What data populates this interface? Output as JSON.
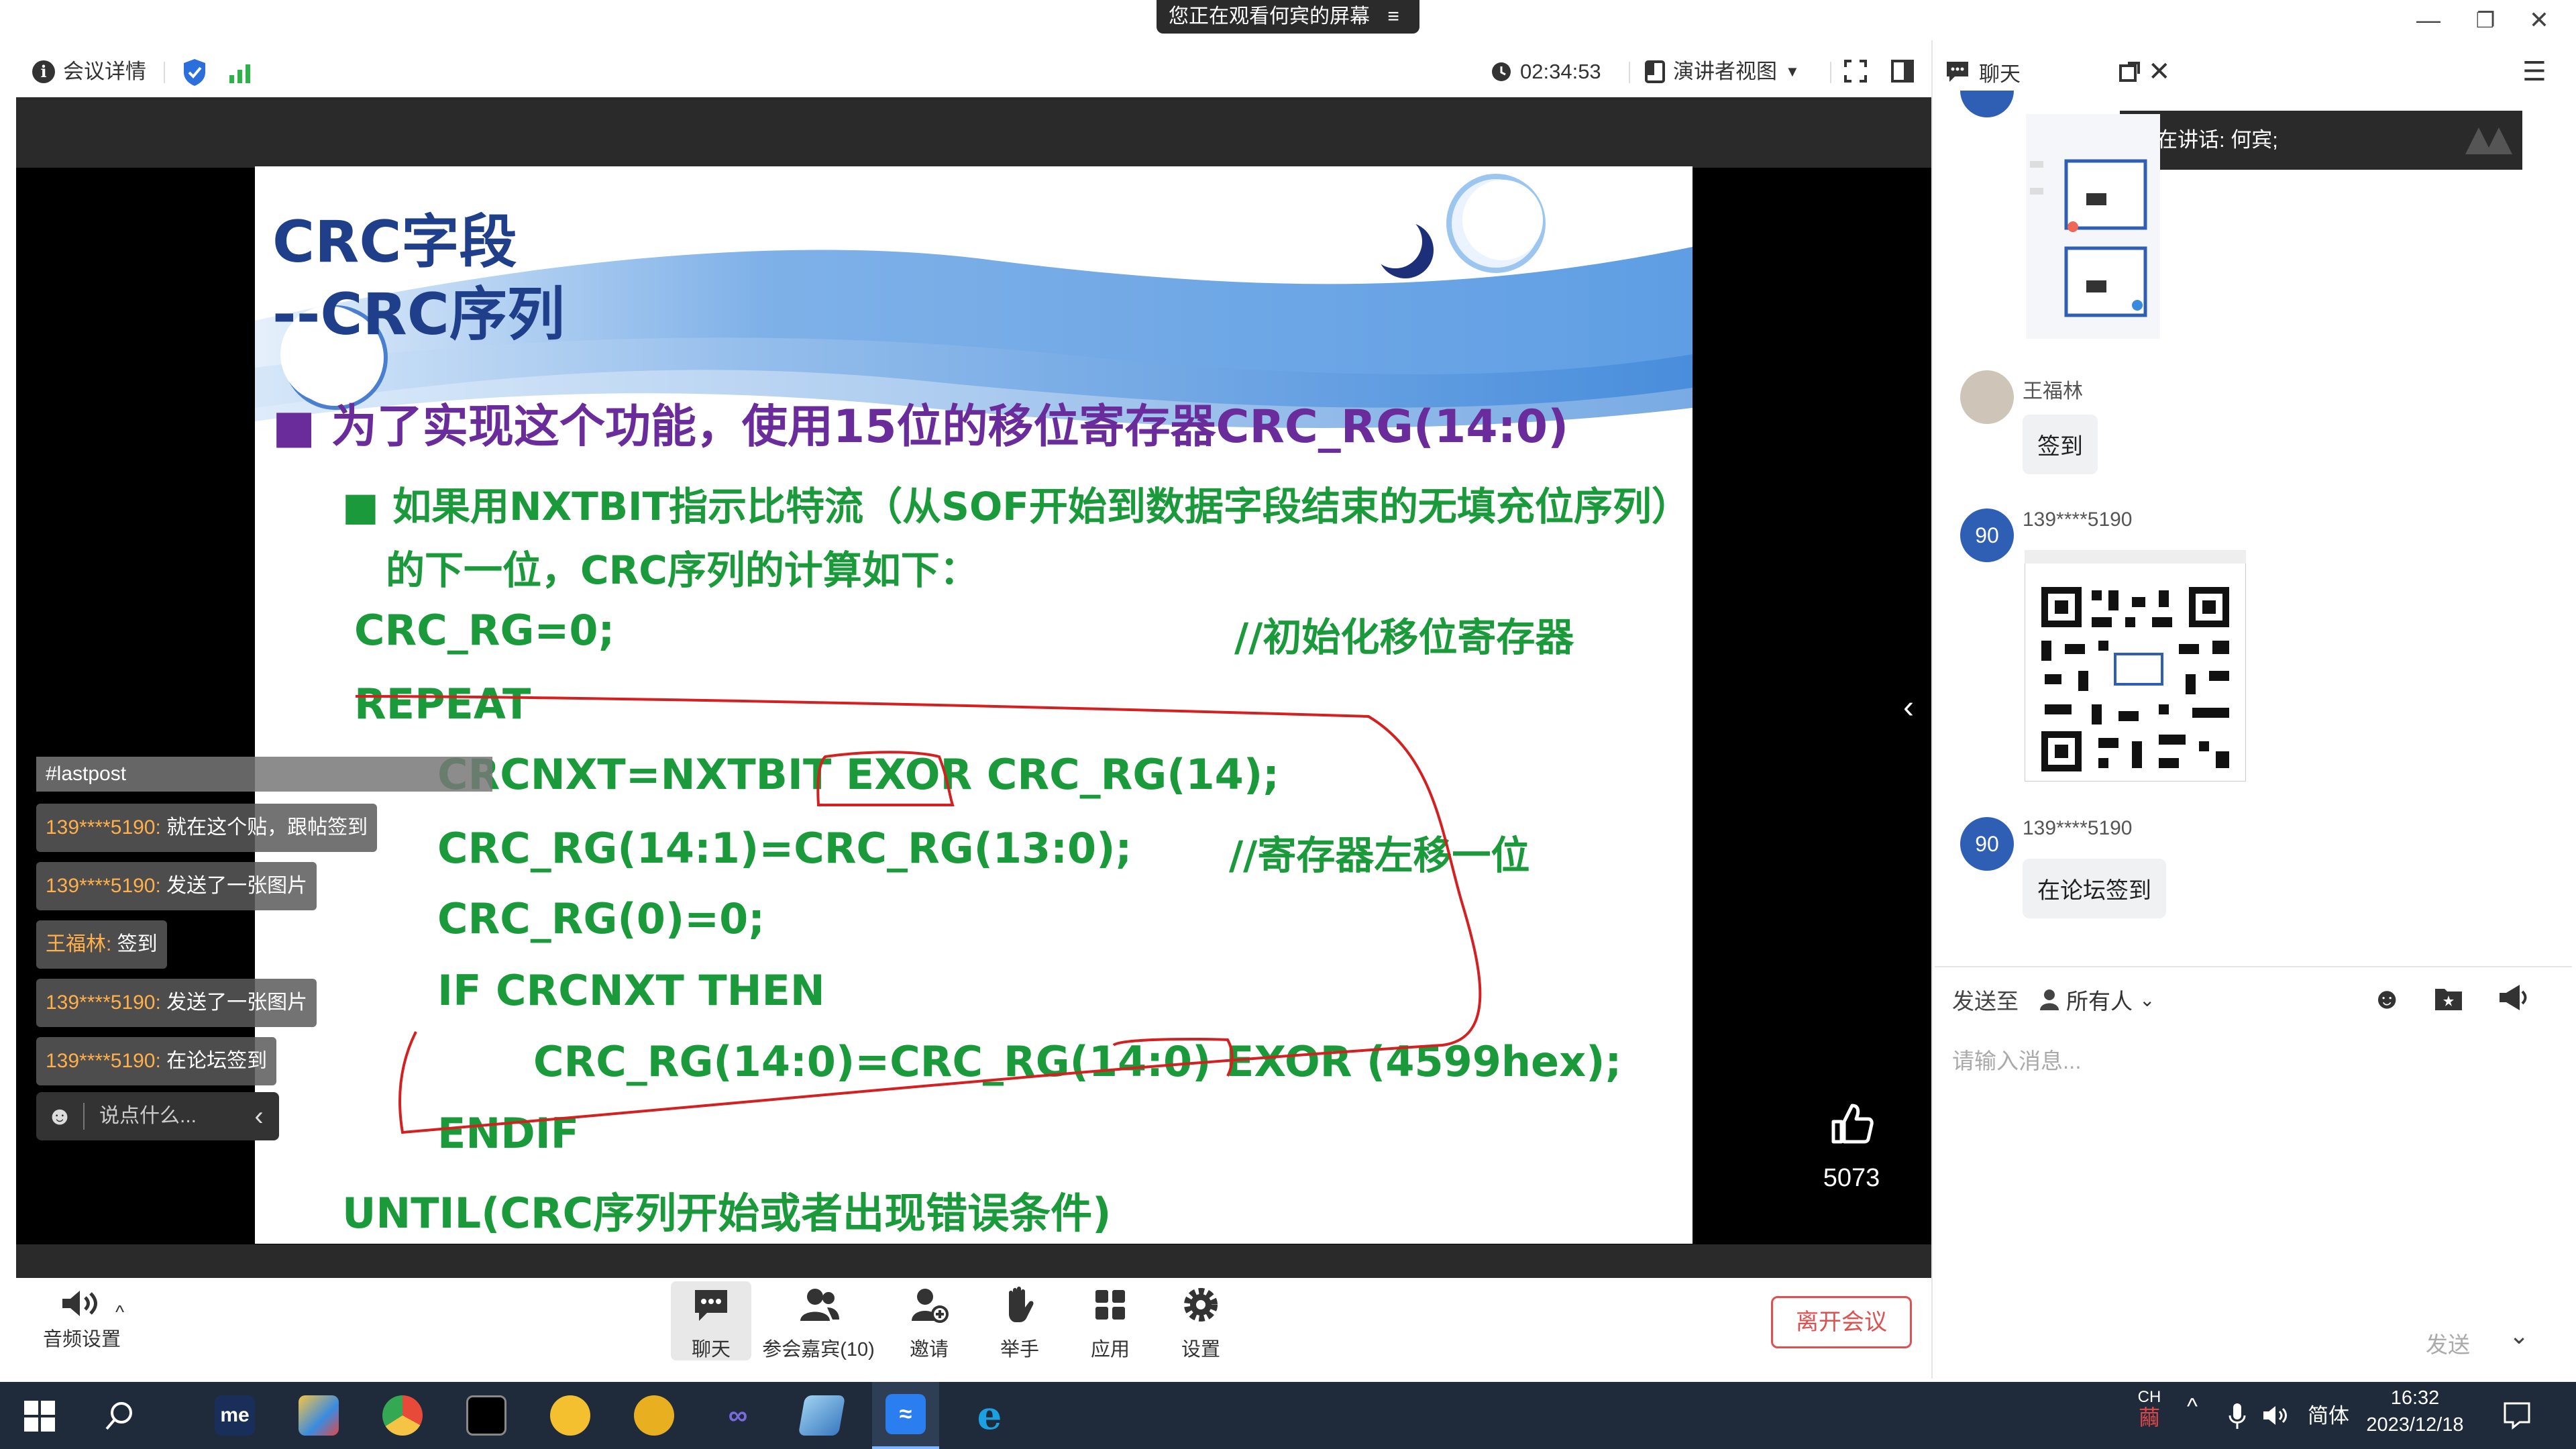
{
  "window": {
    "banner": "您正在观看何宾的屏幕",
    "banner_icon": "≡",
    "min": "—",
    "restore": "❐",
    "close": "✕"
  },
  "toolbar": {
    "meeting_details": "会议详情",
    "timer": "02:34:53",
    "presenter_view": "演讲者视图"
  },
  "chat": {
    "title": "聊天",
    "speaking": "正在讲话:  何宾;",
    "messages": [
      {
        "avatar": "",
        "name": "王福林",
        "text": "签到"
      },
      {
        "avatar": "90",
        "name": "139****5190",
        "text": ""
      },
      {
        "avatar": "90",
        "name": "139****5190",
        "text": "在论坛签到"
      }
    ],
    "send_to_label": "发送至",
    "recipient": "所有人",
    "placeholder": "请输入消息...",
    "send": "发送"
  },
  "slide": {
    "title1": "CRC字段",
    "title2": "--CRC序列",
    "line1": "■ 为了实现这个功能，使用15位的移位寄存器CRC_RG(14:0)",
    "line2": "■ 如果用NXTBIT指示比特流（从SOF开始到数据字段结束的无填充位序列）",
    "line3": "的下一位，CRC序列的计算如下：",
    "code1": "CRC_RG=0;",
    "comment1": "//初始化移位寄存器",
    "code2": "REPEAT",
    "code3": "CRCNXT=NXTBIT EXOR CRC_RG(14);",
    "code4": "CRC_RG(14:1)=CRC_RG(13:0);",
    "comment2": "//寄存器左移一位",
    "code5": "CRC_RG(0)=0;",
    "code6": "IF CRCNXT THEN",
    "code7": "CRC_RG(14:0)=CRC_RG(14:0) EXOR (4599hex);",
    "code8": "ENDIF",
    "code9": "UNTIL(CRC序列开始或者出现错误条件)"
  },
  "danmaku": {
    "head": "#lastpost",
    "items": [
      {
        "user": "139****5190:",
        "text": " 就在这个贴，跟帖签到"
      },
      {
        "user": "139****5190:",
        "text": " 发送了一张图片"
      },
      {
        "user": "王福林:",
        "text": " 签到"
      },
      {
        "user": "139****5190:",
        "text": " 发送了一张图片"
      },
      {
        "user": "139****5190:",
        "text": " 在论坛签到"
      }
    ],
    "input_placeholder": "说点什么..."
  },
  "likes": "5073",
  "bottom": {
    "audio": "音频设置",
    "buttons": [
      {
        "label": "聊天",
        "icon": "chat-icon"
      },
      {
        "label": "参会嘉宾(10)",
        "icon": "participants-icon"
      },
      {
        "label": "邀请",
        "icon": "invite-icon"
      },
      {
        "label": "举手",
        "icon": "hand-icon"
      },
      {
        "label": "应用",
        "icon": "apps-icon"
      },
      {
        "label": "设置",
        "icon": "settings-icon"
      }
    ],
    "leave": "离开会议"
  },
  "taskbar": {
    "me": "me",
    "lang_top": "CH",
    "lang_bottom": "繭",
    "ime": "简体",
    "time": "16:32",
    "date": "2023/12/18"
  },
  "colors": {
    "slide_green": "#1a9a3a",
    "slide_purple": "#6a2c9a",
    "slide_title": "#1f3f8a",
    "annotation": "#d42020",
    "avatar_blue": "#2f5fb5",
    "leave_red": "#e05050"
  }
}
